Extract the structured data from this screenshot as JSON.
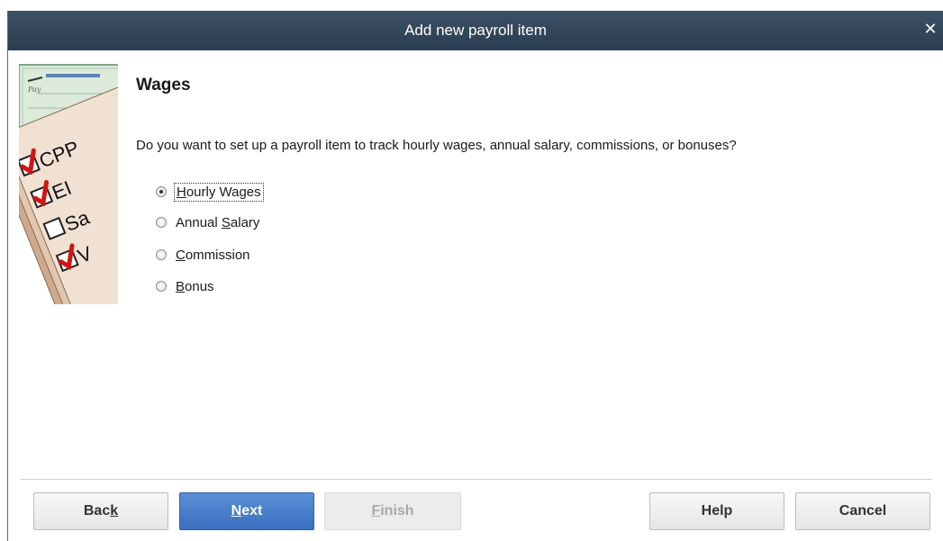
{
  "window": {
    "title": "Add new payroll item",
    "close_symbol": "✕"
  },
  "illustration": {
    "check_labels": [
      "CPP",
      "EI",
      "Sa",
      "V"
    ],
    "icon": "payroll-checklist-illustration"
  },
  "content": {
    "heading": "Wages",
    "question": "Do you want to set up a payroll item to track hourly wages, annual salary, commissions, or bonuses?",
    "options": [
      {
        "before": "",
        "mnemonic": "H",
        "after": "ourly Wages",
        "selected": true
      },
      {
        "before": "Annual ",
        "mnemonic": "S",
        "after": "alary",
        "selected": false
      },
      {
        "before": "",
        "mnemonic": "C",
        "after": "ommission",
        "selected": false
      },
      {
        "before": "",
        "mnemonic": "B",
        "after": "onus",
        "selected": false
      }
    ]
  },
  "buttons": {
    "back": {
      "before": "Bac",
      "mnemonic": "k",
      "after": ""
    },
    "next": {
      "before": "",
      "mnemonic": "N",
      "after": "ext"
    },
    "finish": {
      "before": "",
      "mnemonic": "F",
      "after": "inish"
    },
    "help": "Help",
    "cancel": "Cancel"
  },
  "colors": {
    "titlebar": "#2e4256",
    "primary_button": "#4a7fcc",
    "check_red": "#d41414"
  }
}
